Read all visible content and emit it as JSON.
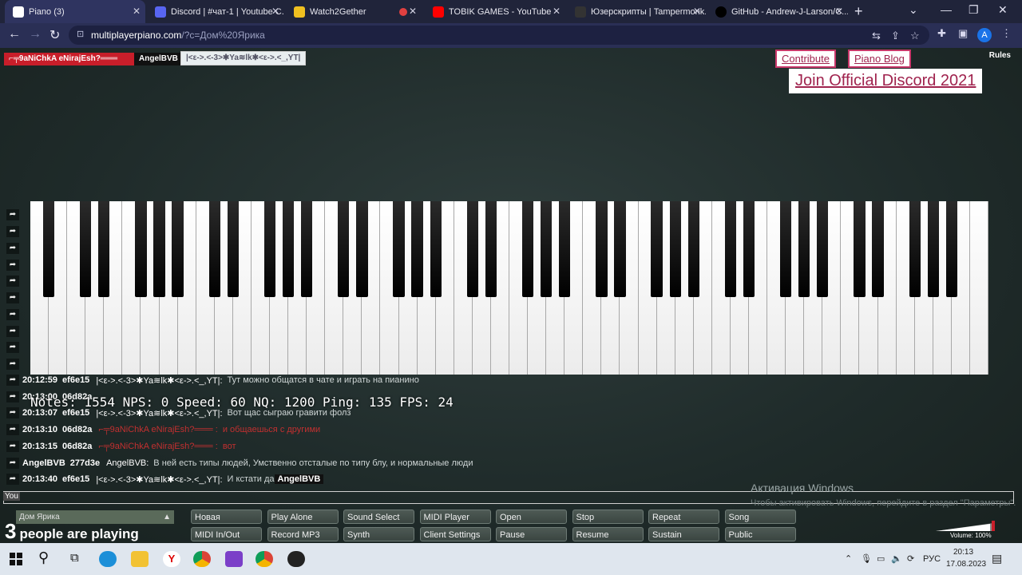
{
  "browser": {
    "tabs": [
      {
        "label": "Piano (3)",
        "active": true
      },
      {
        "label": "Discord | #чат-1 | Youtube C..."
      },
      {
        "label": "Watch2Gether"
      },
      {
        "label": ""
      },
      {
        "label": "TOBIK GAMES - YouTube"
      },
      {
        "label": "Юзерскрипты | Tampermonk..."
      },
      {
        "label": "GitHub - Andrew-J-Larson/C..."
      }
    ],
    "url_host": "multiplayerpiano.com",
    "url_path": "/?c=Дом%20Ярика",
    "profile_initial": "A"
  },
  "header": {
    "user1": "⌐╤9aNiChkA eNirajEsh?═══",
    "user2": "AngelBVB",
    "user3": "|<ε->.<-3>✱Ya≋lk✱<ε->.<_,YT|",
    "contribute": "Contribute",
    "piano_blog": "Piano Blog",
    "discord": "Join Official Discord 2021",
    "rules": "Rules"
  },
  "stats": "Notes: 1554 NPS: 0 Speed: 60 NQ: 1200 Ping: 135 FPS: 24",
  "chat": [
    {
      "time": "20:12:59",
      "uid": "ef6e15",
      "nick": "|<ε->.<-3>✱Ya≋lk✱<ε->.<_,YT|:",
      "msg": "Тут можно общатся в чате и играть на пианино"
    },
    {
      "time": "20:13:00",
      "uid": "06d82a",
      "nick": "",
      "msg": ""
    },
    {
      "time": "20:13:07",
      "uid": "ef6e15",
      "nick": "|<ε->.<-3>✱Ya≋lk✱<ε->.<_,YT|:",
      "msg": "Вот щас сыграю гравити фолз"
    },
    {
      "time": "20:13:10",
      "uid": "06d82a",
      "nick": "⌐╤9aNiChkA eNirajEsh?═══ :",
      "msg": "и общаешься с другими",
      "red": true
    },
    {
      "time": "20:13:15",
      "uid": "06d82a",
      "nick": "⌐╤9aNiChkA eNirajEsh?═══ :",
      "msg": "вот",
      "red": true
    },
    {
      "time": "AngelBVB",
      "uid": "277d3e",
      "nick": "AngelBVB:",
      "msg": "В ней есть типы людей, Умственно отсталые по типу блу, и нормальные люди"
    },
    {
      "time": "20:13:40",
      "uid": "ef6e15",
      "nick": "|<ε->.<-3>✱Ya≋lk✱<ε->.<_,YT|:",
      "msg": "И кстати да"
    }
  ],
  "chat_reply": "AngelBVB",
  "chat_input_label": "You",
  "activation_title": "Активация Windows",
  "activation_sub": "Чтобы активировать Windows, перейдите в раздел \"Параметры\".",
  "room_select": "Дом Ярика",
  "players_count": "3",
  "players_text": "people are playing",
  "controls": [
    "Новая комната...",
    "Play Alone",
    "Sound Select",
    "MIDI Player",
    "Open",
    "Stop",
    "Repeat",
    "Song",
    "MIDI In/Out",
    "Record MP3",
    "Synth",
    "Client Settings",
    "Pause",
    "Resume",
    "Sustain",
    "Public"
  ],
  "volume_label": "Volume: 100%",
  "taskbar": {
    "lang": "РУС",
    "time": "20:13",
    "date": "17.08.2023"
  }
}
